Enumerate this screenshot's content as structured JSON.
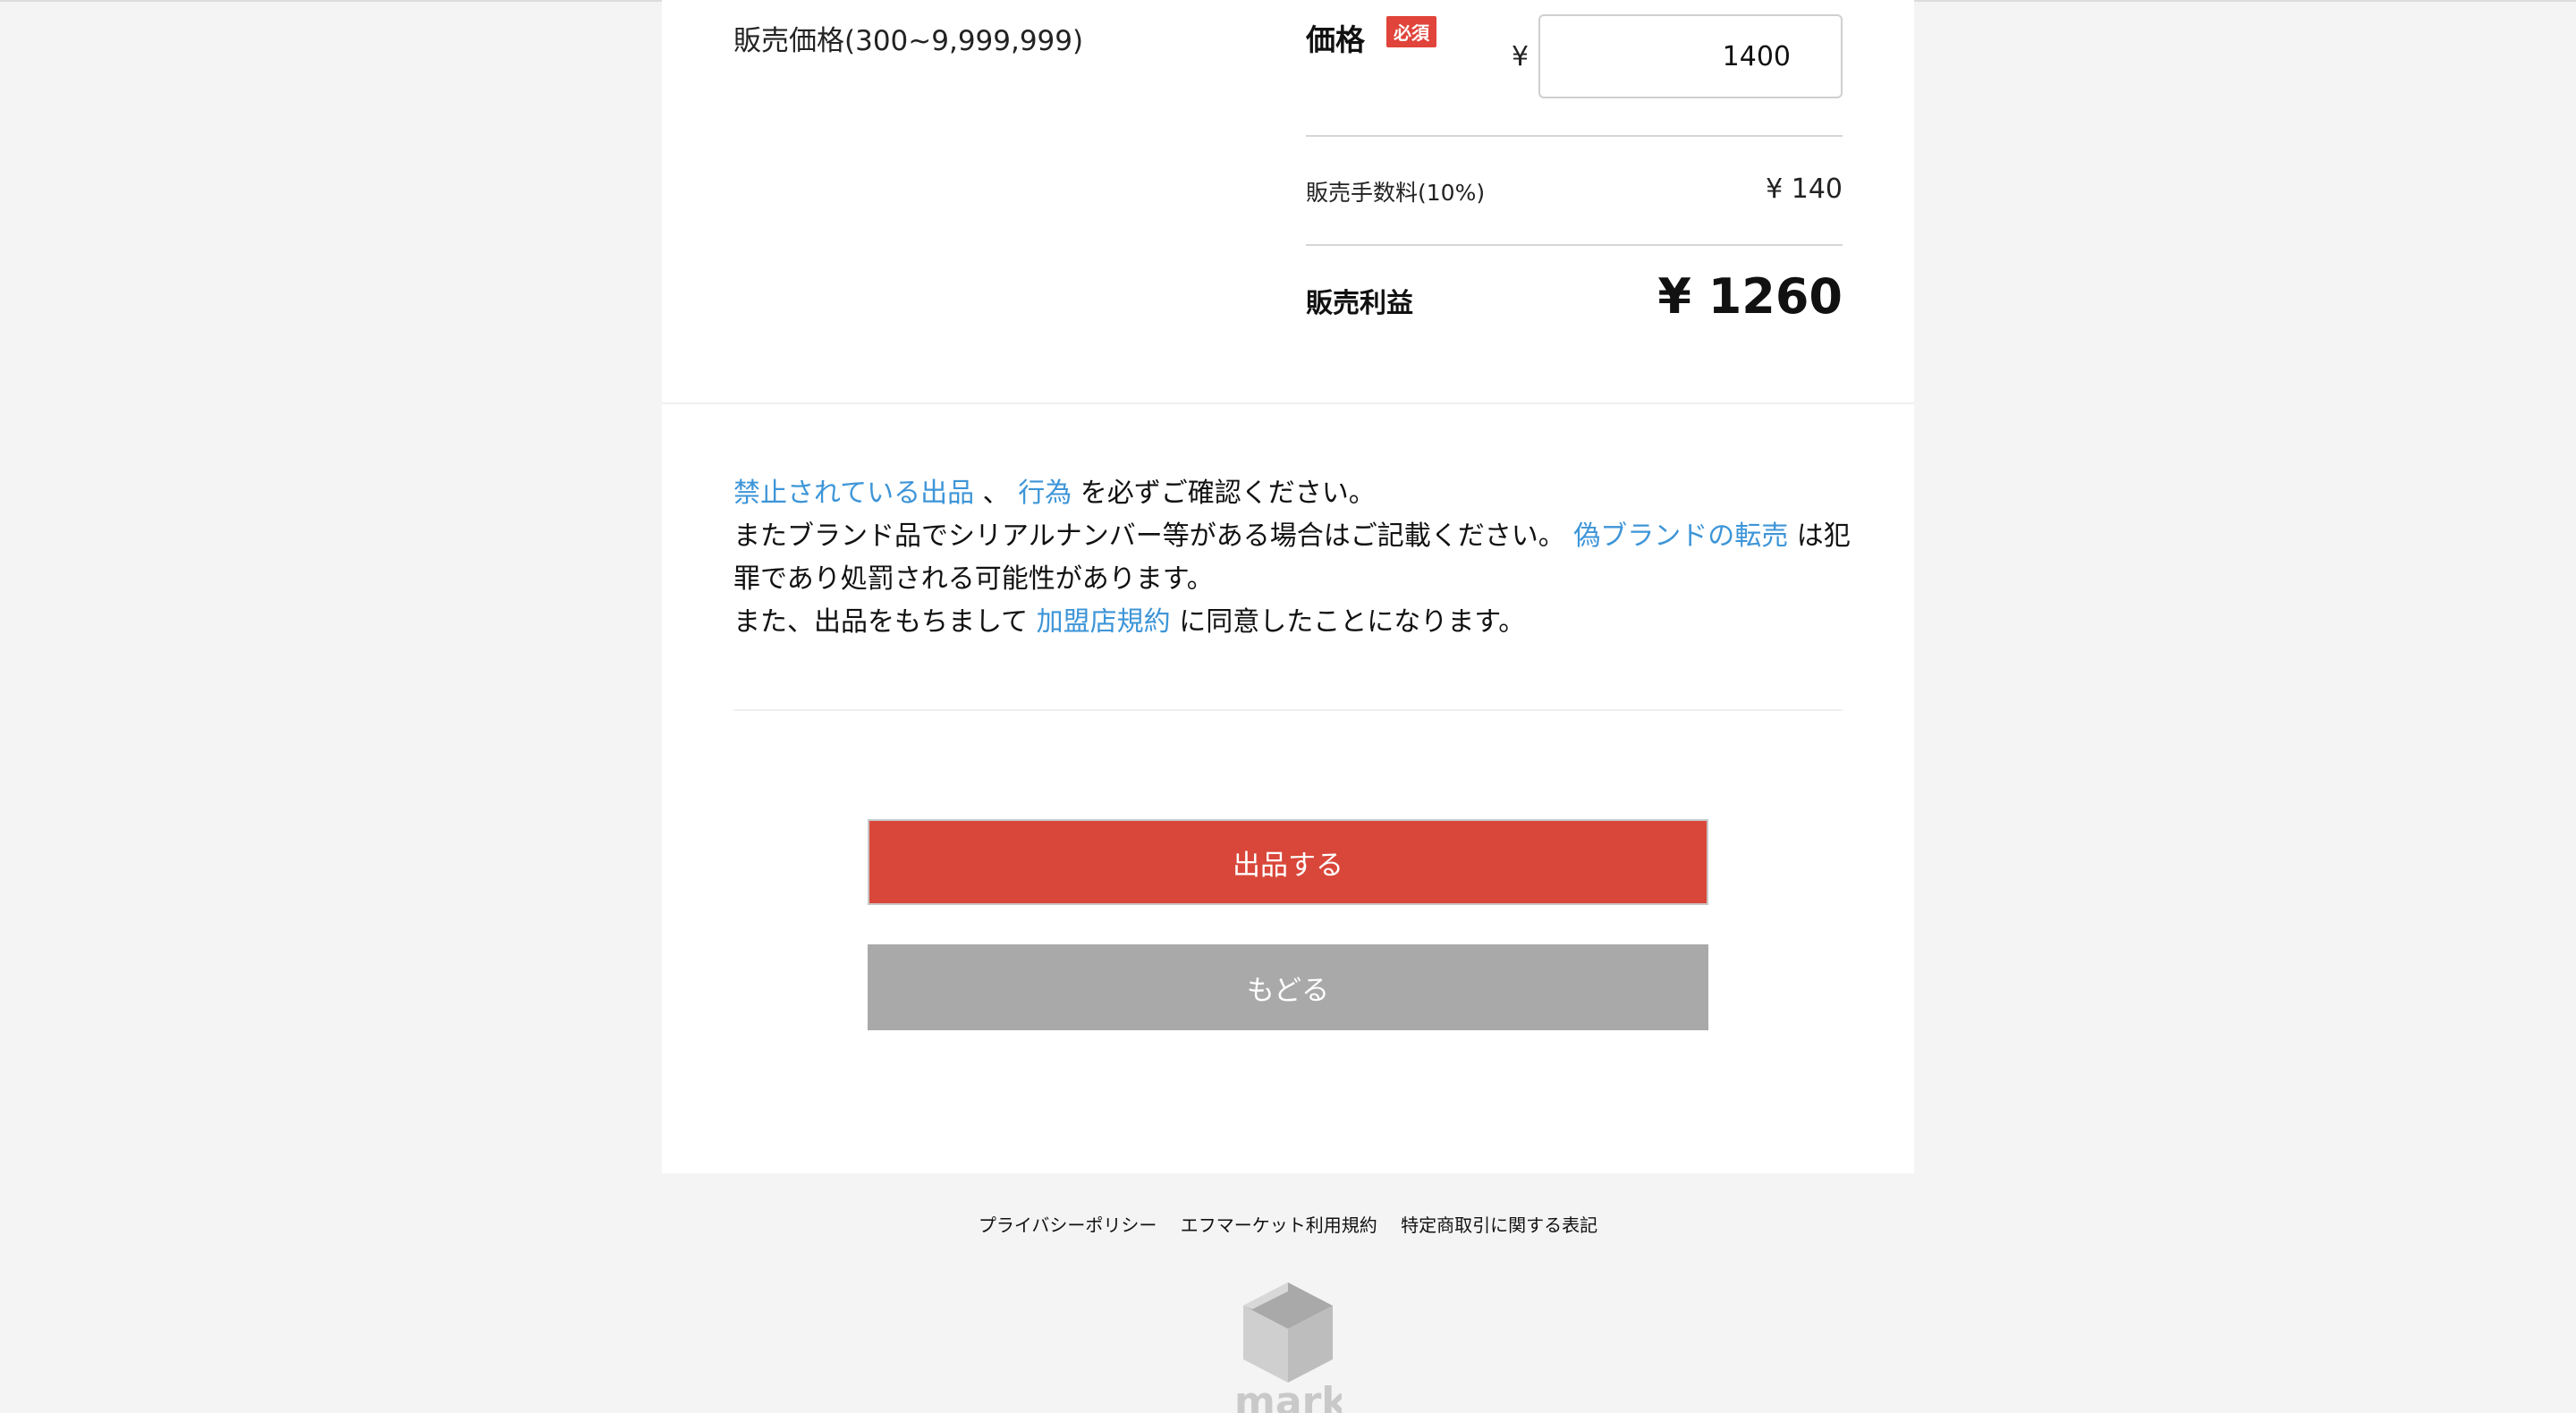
{
  "price_section": {
    "left_label": "販売価格(300~9,999,999)",
    "price_heading": "価格",
    "required_badge": "必須",
    "currency_symbol": "¥",
    "price_value": "1400",
    "fee_label": "販売手数料(10%)",
    "fee_value": "¥ 140",
    "profit_label": "販売利益",
    "profit_value": "¥ 1260"
  },
  "notice": {
    "link_prohibited_items": "禁止されている出品",
    "separator": "、",
    "link_acts": "行為",
    "text_1": "を必ずご確認ください。",
    "text_2": "またブランド品でシリアルナンバー等がある場合はご記載ください。",
    "link_fake_brand": "偽ブランドの転売",
    "text_3": "は犯罪であり処罰される可能性があります。",
    "text_4": "また、出品をもちまして",
    "link_member_terms": "加盟店規約",
    "text_5": "に同意したことになります。"
  },
  "buttons": {
    "submit_label": "出品する",
    "back_label": "もどる"
  },
  "footer": {
    "privacy_policy": "プライバシーポリシー",
    "terms_of_use": "エフマーケット利用規約",
    "commerce_law": "特定商取引に関する表記",
    "logo_text": "Fmarket"
  },
  "colors": {
    "accent_red": "#d9473a",
    "link_blue": "#3d95d8",
    "back_gray": "#a9a9a9"
  }
}
